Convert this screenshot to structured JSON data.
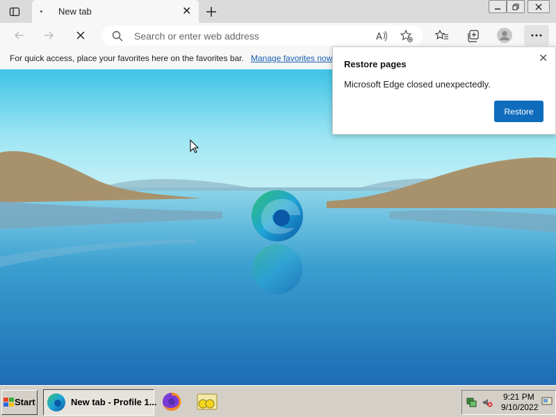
{
  "browser": {
    "tab_title": "New tab",
    "address_placeholder": "Search or enter web address",
    "favorites_message": "For quick access, place your favorites here on the favorites bar.",
    "favorites_link": "Manage favorites now"
  },
  "popup": {
    "title": "Restore pages",
    "message": "Microsoft Edge closed unexpectedly.",
    "button": "Restore"
  },
  "taskbar": {
    "start_label": "Start",
    "task_label": "New tab - Profile 1...",
    "time": "9:21 PM",
    "date": "9/10/2022"
  },
  "colors": {
    "accent": "#0f6cbd",
    "link": "#1a5fb4",
    "taskbar": "#d4d0c8"
  }
}
